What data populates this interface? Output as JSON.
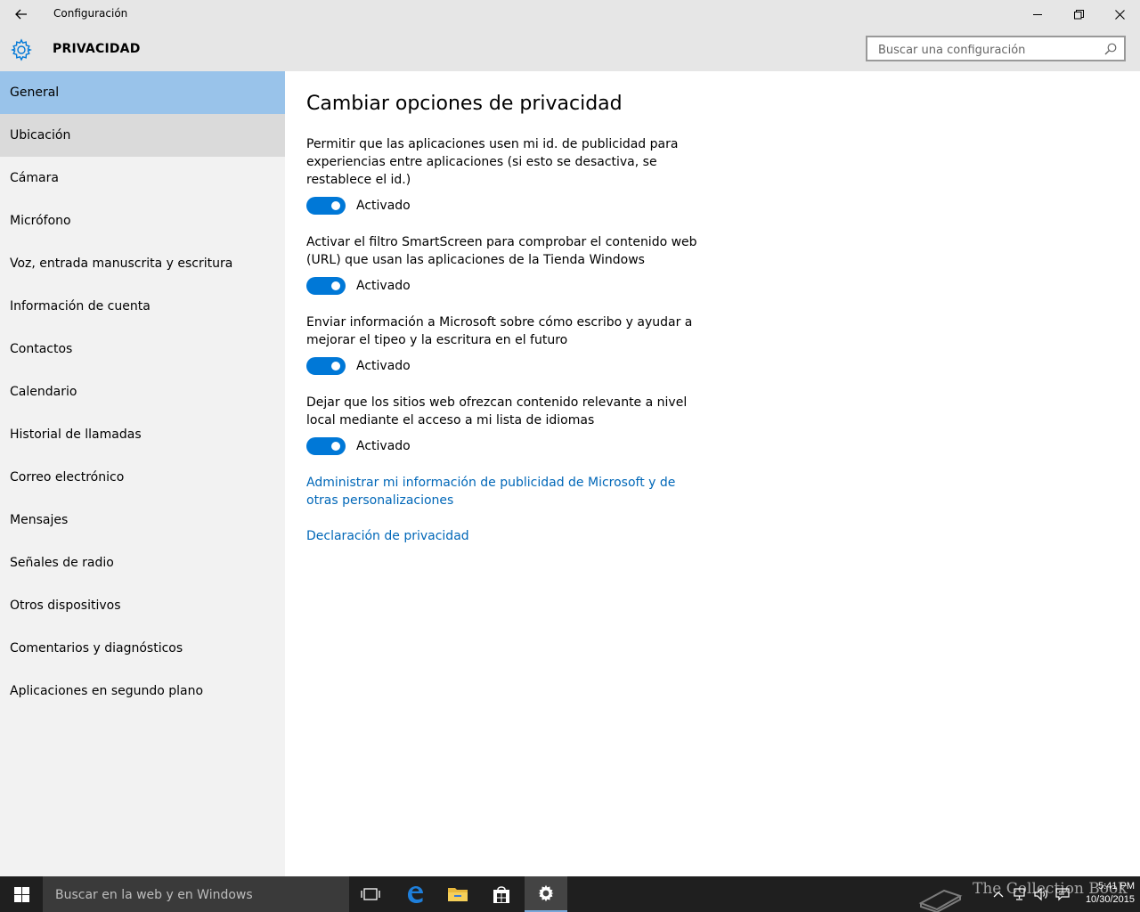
{
  "window": {
    "title": "Configuración"
  },
  "header": {
    "section_title": "PRIVACIDAD",
    "search_placeholder": "Buscar una configuración"
  },
  "sidebar": {
    "items": [
      {
        "label": "General",
        "state": "selected"
      },
      {
        "label": "Ubicación",
        "state": "hover"
      },
      {
        "label": "Cámara"
      },
      {
        "label": "Micrófono"
      },
      {
        "label": "Voz, entrada manuscrita y escritura"
      },
      {
        "label": "Información de cuenta"
      },
      {
        "label": "Contactos"
      },
      {
        "label": "Calendario"
      },
      {
        "label": "Historial de llamadas"
      },
      {
        "label": "Correo electrónico"
      },
      {
        "label": "Mensajes"
      },
      {
        "label": "Señales de radio"
      },
      {
        "label": "Otros dispositivos"
      },
      {
        "label": "Comentarios y diagnósticos"
      },
      {
        "label": "Aplicaciones en segundo plano"
      }
    ]
  },
  "main": {
    "title": "Cambiar opciones de privacidad",
    "settings": [
      {
        "description": "Permitir que las aplicaciones usen mi id. de publicidad para experiencias entre aplicaciones (si esto se desactiva, se restablece el id.)",
        "toggle_label": "Activado",
        "on": true
      },
      {
        "description": "Activar el filtro SmartScreen para comprobar el contenido web (URL) que usan las aplicaciones de la Tienda Windows",
        "toggle_label": "Activado",
        "on": true
      },
      {
        "description": "Enviar información a Microsoft sobre cómo escribo y ayudar a mejorar el tipeo y la escritura en el futuro",
        "toggle_label": "Activado",
        "on": true
      },
      {
        "description": "Dejar que los sitios web ofrezcan contenido relevante a nivel local mediante el acceso a mi lista de idiomas",
        "toggle_label": "Activado",
        "on": true
      }
    ],
    "links": {
      "manage_ads": "Administrar mi información de publicidad de Microsoft y de otras personalizaciones",
      "privacy_statement": "Declaración de privacidad"
    }
  },
  "taskbar": {
    "search_placeholder": "Buscar en la web y en Windows",
    "watermark": "The Collection Book",
    "time": "5:41 PM",
    "date": "10/30/2015"
  },
  "colors": {
    "accent": "#0078d7",
    "link": "#0067b8",
    "selected_nav": "#99c3ea",
    "sidebar_bg": "#f2f2f2",
    "chrome_bg": "#e6e6e6",
    "taskbar_bg": "#1f1f1f"
  },
  "icons": {
    "back": "back-arrow-icon",
    "settings": "gear-icon",
    "search": "search-icon",
    "minimize": "minimize-icon",
    "restore": "restore-icon",
    "close": "close-icon"
  }
}
